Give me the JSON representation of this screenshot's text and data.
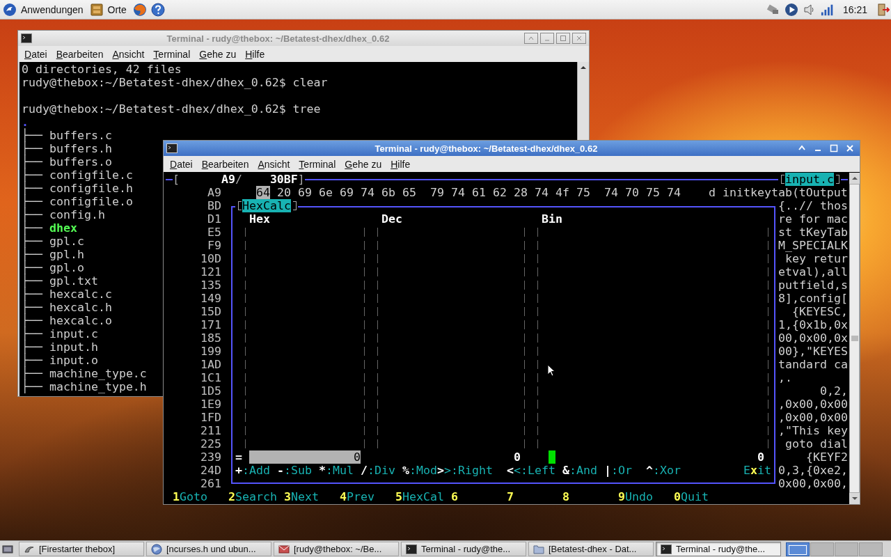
{
  "top_panel": {
    "menus": [
      "Anwendungen",
      "Orte"
    ],
    "clock": "16:21"
  },
  "back_terminal": {
    "active": false,
    "title": "Terminal - rudy@thebox: ~/Betatest-dhex/dhex_0.62",
    "menu": [
      "Datei",
      "Bearbeiten",
      "Ansicht",
      "Terminal",
      "Gehe zu",
      "Hilfe"
    ],
    "screen": [
      {
        "kind": "text",
        "text": "0 directories, 42 files"
      },
      {
        "kind": "text",
        "text": "rudy@thebox:~/Betatest-dhex/dhex_0.62$ clear"
      },
      {
        "kind": "blank"
      },
      {
        "kind": "text",
        "text": "rudy@thebox:~/Betatest-dhex/dhex_0.62$ tree"
      },
      {
        "kind": "dot",
        "text": "."
      }
    ],
    "tree": [
      {
        "branch": "├──",
        "name": "buffers.c",
        "kind": "file"
      },
      {
        "branch": "├──",
        "name": "buffers.h",
        "kind": "file"
      },
      {
        "branch": "├──",
        "name": "buffers.o",
        "kind": "file"
      },
      {
        "branch": "├──",
        "name": "configfile.c",
        "kind": "file"
      },
      {
        "branch": "├──",
        "name": "configfile.h",
        "kind": "file"
      },
      {
        "branch": "├──",
        "name": "configfile.o",
        "kind": "file"
      },
      {
        "branch": "├──",
        "name": "config.h",
        "kind": "file"
      },
      {
        "branch": "├──",
        "name": "dhex",
        "kind": "executable"
      },
      {
        "branch": "├──",
        "name": "gpl.c",
        "kind": "file"
      },
      {
        "branch": "├──",
        "name": "gpl.h",
        "kind": "file"
      },
      {
        "branch": "├──",
        "name": "gpl.o",
        "kind": "file"
      },
      {
        "branch": "├──",
        "name": "gpl.txt",
        "kind": "file"
      },
      {
        "branch": "├──",
        "name": "hexcalc.c",
        "kind": "file"
      },
      {
        "branch": "├──",
        "name": "hexcalc.h",
        "kind": "file"
      },
      {
        "branch": "├──",
        "name": "hexcalc.o",
        "kind": "file"
      },
      {
        "branch": "├──",
        "name": "input.c",
        "kind": "file"
      },
      {
        "branch": "├──",
        "name": "input.h",
        "kind": "file"
      },
      {
        "branch": "├──",
        "name": "input.o",
        "kind": "file"
      },
      {
        "branch": "├──",
        "name": "machine_type.c",
        "kind": "file"
      },
      {
        "branch": "├──",
        "name": "machine_type.h",
        "kind": "file"
      }
    ]
  },
  "front_terminal": {
    "active": true,
    "title": "Terminal - rudy@thebox: ~/Betatest-dhex/dhex_0.62",
    "menu": [
      "Datei",
      "Bearbeiten",
      "Ansicht",
      "Terminal",
      "Gehe zu",
      "Hilfe"
    ],
    "dhex": {
      "position_label": "[      **A9**/    **30BF**]",
      "file_name": "input.c",
      "first_row": {
        "address": "A9",
        "bytes": [
          {
            "value": "64",
            "selected": true
          },
          {
            "value": "20",
            "selected": false
          },
          {
            "value": "69",
            "selected": false
          },
          {
            "value": "6e",
            "selected": false
          },
          {
            "value": "69",
            "selected": false
          },
          {
            "value": "74",
            "selected": false
          },
          {
            "value": "6b",
            "selected": false
          },
          {
            "value": "65",
            "selected": false
          },
          {
            "value": "79",
            "selected": false
          },
          {
            "value": "74",
            "selected": false
          },
          {
            "value": "61",
            "selected": false
          },
          {
            "value": "62",
            "selected": false
          },
          {
            "value": "28",
            "selected": false
          },
          {
            "value": "74",
            "selected": false
          },
          {
            "value": "4f",
            "selected": false
          },
          {
            "value": "75",
            "selected": false
          },
          {
            "value": "74",
            "selected": false
          },
          {
            "value": "70",
            "selected": false
          },
          {
            "value": "75",
            "selected": false
          },
          {
            "value": "74",
            "selected": false
          }
        ],
        "ascii": "d initkeytab(tOutput"
      },
      "addresses": [
        "BD",
        "D1",
        "E5",
        "F9",
        "10D",
        "121",
        "135",
        "149",
        "15D",
        "171",
        "185",
        "199",
        "1AD",
        "1C1",
        "1D5",
        "1E9",
        "1FD",
        "211",
        "225",
        "239",
        "24D",
        "261"
      ],
      "ascii_column": [
        "{..// thos",
        "re for mac",
        "st tKeyTab",
        "M_SPECIALK",
        " key retur",
        "etval),all",
        "putfield,s",
        "8],config[",
        "  {KEYESC,",
        "1,{0x1b,0x",
        "00,0x00,0x",
        "00},\"KEYES",
        "tandard ca",
        ",.",
        "      0,2,",
        ",0x00,0x00",
        ",0x00,0x00",
        ",\"This key",
        " goto dial",
        "    {KEYF2",
        "0,3,{0xe2,",
        "0x00,0x00,"
      ],
      "hexcalc": {
        "title": "HexCalc",
        "columns": [
          "Hex",
          "Dec",
          "Bin"
        ],
        "result": {
          "sign": "=",
          "hex": "0",
          "dec": "0",
          "bin": "0"
        },
        "operations": [
          {
            "key": "+",
            "label": ":Add"
          },
          {
            "key": "-",
            "label": ":Sub"
          },
          {
            "key": "*",
            "label": ":Mul"
          },
          {
            "key": "/",
            "label": ":Div"
          },
          {
            "key": "%",
            "label": ":Mod"
          },
          {
            "key": ">",
            "label": ">:Right"
          },
          {
            "key": "<",
            "label": "<:Left"
          },
          {
            "key": "&",
            "label": ":And"
          },
          {
            "key": "|",
            "label": ":Or"
          },
          {
            "key": "^",
            "label": ":Xor"
          }
        ],
        "exit": "E**x**it"
      },
      "function_keys": [
        {
          "key": "1",
          "label": "Goto"
        },
        {
          "key": "2",
          "label": "Search"
        },
        {
          "key": "3",
          "label": "Next"
        },
        {
          "key": "4",
          "label": "Prev"
        },
        {
          "key": "5",
          "label": "HexCal"
        },
        {
          "key": "6"
        },
        {
          "key": "7"
        },
        {
          "key": "8"
        },
        {
          "key": "9",
          "label": "Undo"
        },
        {
          "key": "0",
          "label": "Quit"
        }
      ]
    }
  },
  "taskbar": [
    {
      "kind": "firewall",
      "label": "[Firestarter thebox]",
      "selected": false
    },
    {
      "kind": "browser",
      "label": "[ncurses.h und ubun...",
      "selected": false
    },
    {
      "kind": "mail",
      "label": "[rudy@thebox: ~/Be...",
      "selected": false
    },
    {
      "kind": "terminal",
      "label": "Terminal - rudy@the...",
      "selected": false
    },
    {
      "kind": "folder",
      "label": "[Betatest-dhex - Dat...",
      "selected": false
    },
    {
      "kind": "terminal",
      "label": "Terminal - rudy@the...",
      "selected": true
    }
  ]
}
